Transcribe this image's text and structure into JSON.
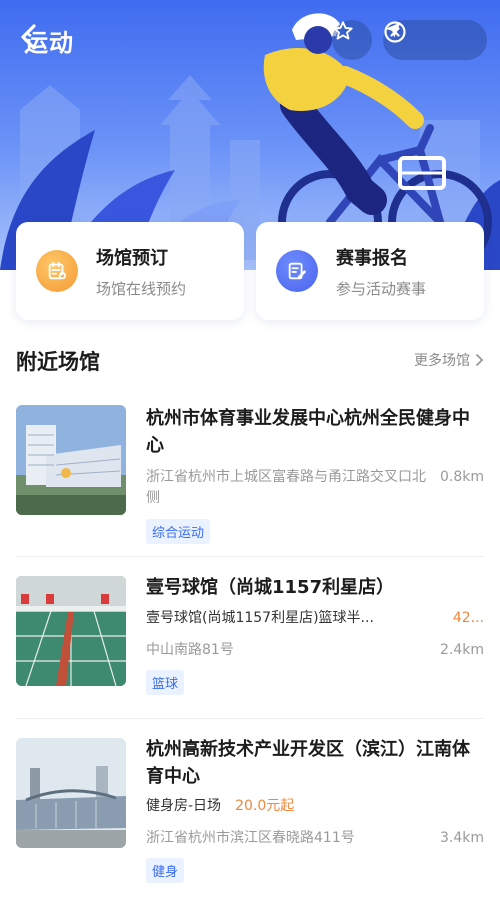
{
  "header": {
    "back_label": "运动",
    "icons": [
      "chevron-left-icon",
      "star-icon",
      "location-arrow-icon",
      "close-circle-icon"
    ]
  },
  "services": [
    {
      "title": "场馆预订",
      "subtitle": "场馆在线预约",
      "icon": "calendar-icon",
      "color": "#f5a13c"
    },
    {
      "title": "赛事报名",
      "subtitle": "参与活动赛事",
      "icon": "edit-form-icon",
      "color": "#4f6bf0"
    }
  ],
  "nearby": {
    "title": "附近场馆",
    "more_label": "更多场馆",
    "venues": [
      {
        "name": "杭州市体育事业发展中心杭州全民健身中心",
        "address": "浙江省杭州市上城区富春路与甬江路交叉口北侧",
        "distance": "0.8km",
        "tag": "综合运动"
      },
      {
        "name": "壹号球馆（尚城1157利星店）",
        "product": "壹号球馆(尚城1157利星店)篮球半...",
        "price": "42...",
        "address": "中山南路81号",
        "distance": "2.4km",
        "tag": "篮球"
      },
      {
        "name": "杭州高新技术产业开发区（滨江）江南体育中心",
        "product": "健身房-日场",
        "price": "20.0元起",
        "address": "浙江省杭州市滨江区春晓路411号",
        "distance": "3.4km",
        "tag": "健身"
      }
    ]
  },
  "colors": {
    "hero_blue": "#3f6cf0",
    "accent_blue": "#3a6df0",
    "price_orange": "#f0883e",
    "tag_bg": "#eaf1ff"
  }
}
